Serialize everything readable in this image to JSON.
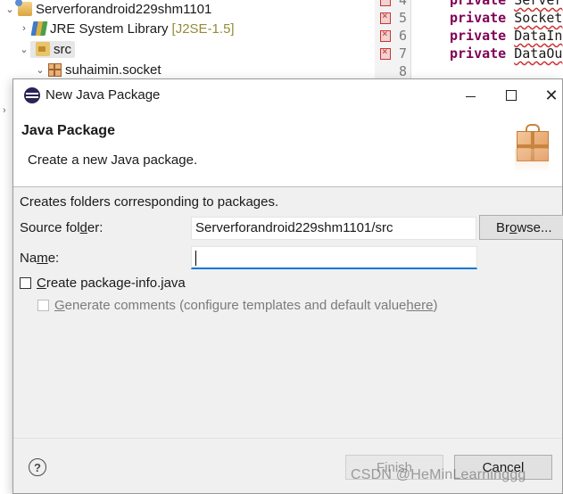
{
  "explorer": {
    "project": {
      "name": "Serverforandroid229shm1101"
    },
    "jre": {
      "label": "JRE System Library",
      "version": "[J2SE-1.5]"
    },
    "src": {
      "label": "src"
    },
    "package": {
      "label": "suhaimin.socket"
    }
  },
  "editor": {
    "lines": [
      {
        "number": "4",
        "keyword": "private",
        "type": "Server"
      },
      {
        "number": "5",
        "keyword": "private",
        "type": "Socket"
      },
      {
        "number": "6",
        "keyword": "private",
        "type": "DataIn"
      },
      {
        "number": "7",
        "keyword": "private",
        "type": "DataOu"
      },
      {
        "number": "8",
        "keyword": "",
        "type": ""
      }
    ]
  },
  "dialog": {
    "title": "New Java Package",
    "banner": {
      "title": "Java Package",
      "message": "Create a new Java package."
    },
    "description": "Creates folders corresponding to packages.",
    "source_folder": {
      "label_pre": "Source fol",
      "label_mnemonic": "d",
      "label_post": "er:",
      "value": "Serverforandroid229shm1101/src"
    },
    "browse": {
      "label_pre": "Br",
      "label_mnemonic": "o",
      "label_post": "wse..."
    },
    "name": {
      "label_pre": "Na",
      "label_mnemonic": "m",
      "label_post": "e:",
      "value": ""
    },
    "create_package_info": {
      "label_mnemonic": "C",
      "label_post": "reate package-info.java",
      "checked": false
    },
    "generate_comments": {
      "label_mnemonic": "G",
      "label_post": "enerate comments (configure templates and default value ",
      "link": "here",
      "label_end": ")",
      "checked": false,
      "enabled": false
    },
    "help_label": "?",
    "finish_label": "Finish",
    "cancel_label": "Cancel"
  },
  "watermark": "CSDN @HeMinLearninggg",
  "colors": {
    "keyword": "#7f0055",
    "focus_underline": "#0078d7",
    "dialog_bg": "#f0f0f0"
  }
}
